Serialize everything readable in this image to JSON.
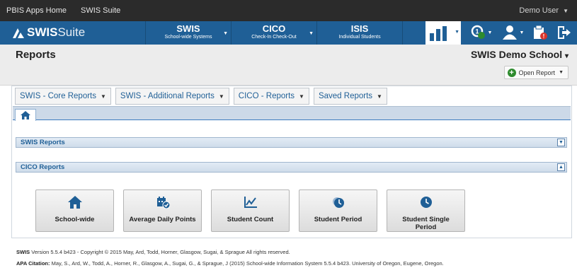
{
  "topbar": {
    "links": [
      "PBIS Apps Home",
      "SWIS Suite"
    ],
    "user": "Demo User"
  },
  "navbar": {
    "brand_bold": "SWIS",
    "brand_light": "Suite",
    "menus": [
      {
        "title": "SWIS",
        "subtitle": "School-wide Systems"
      },
      {
        "title": "CICO",
        "subtitle": "Check-In Check-Out"
      },
      {
        "title": "ISIS",
        "subtitle": "Individual Students"
      }
    ],
    "icons": [
      "reports-bar-chart-icon",
      "support-icon",
      "users-icon",
      "alerts-icon",
      "logout-icon"
    ]
  },
  "header": {
    "title": "Reports",
    "school": "SWIS Demo School",
    "open_report": "Open Report"
  },
  "report_tabs": [
    "SWIS - Core Reports",
    "SWIS - Additional Reports",
    "CICO - Reports",
    "Saved Reports"
  ],
  "sections": {
    "swis": "SWIS Reports",
    "cico": "CICO Reports"
  },
  "cico_reports": [
    {
      "label": "School-wide",
      "icon": "home-icon"
    },
    {
      "label": "Average Daily Points",
      "icon": "calendar-check-icon"
    },
    {
      "label": "Student Count",
      "icon": "line-chart-icon"
    },
    {
      "label": "Student Period",
      "icon": "clock-icon"
    },
    {
      "label": "Student Single Period",
      "icon": "clock-icon"
    }
  ],
  "footer": {
    "version_label": "SWIS",
    "version_text": "Version 5.5.4 b423 - Copyright © 2015 May, Ard, Todd, Horner, Glasgow, Sugai, & Sprague All rights reserved.",
    "citation_label": "APA Citation:",
    "citation_text": "May, S., Ard, W., Todd, A., Horner, R., Glasgow, A., Sugai, G., & Sprague, J (2015) School-wide Information System 5.5.4 b423. University of Oregon, Eugene, Oregon."
  },
  "colors": {
    "navbar": "#1f5f96",
    "topbar": "#2b2b2b",
    "accent_green": "#2e8b2e",
    "alert_red": "#d9342b"
  }
}
